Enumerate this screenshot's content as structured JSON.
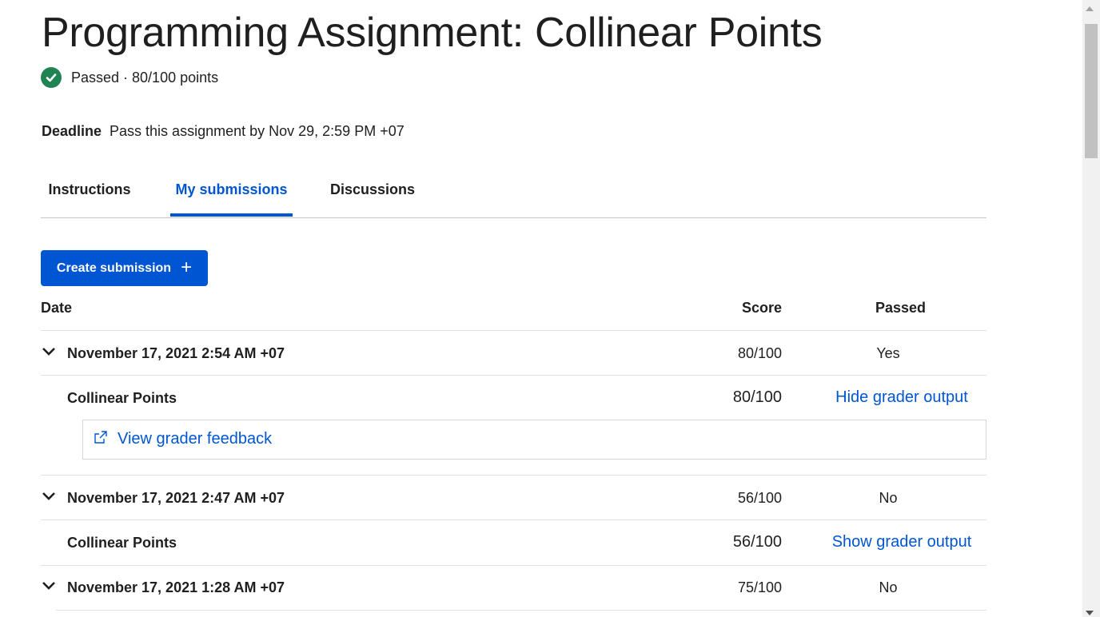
{
  "page": {
    "title": "Programming Assignment: Collinear Points",
    "status": "Passed · 80/100 points",
    "deadline_label": "Deadline",
    "deadline_text": "Pass this assignment by Nov 29, 2:59 PM +07"
  },
  "tabs": [
    {
      "label": "Instructions",
      "active": false
    },
    {
      "label": "My submissions",
      "active": true
    },
    {
      "label": "Discussions",
      "active": false
    }
  ],
  "create_button": {
    "label": "Create submission"
  },
  "table": {
    "headers": {
      "date": "Date",
      "score": "Score",
      "passed": "Passed"
    },
    "submissions": [
      {
        "date": "November 17, 2021 2:54 AM +07",
        "score": "80/100",
        "passed": "Yes",
        "expanded": true,
        "item": {
          "name": "Collinear Points",
          "score": "80/100",
          "toggle": "Hide grader output",
          "feedback_link": "View grader feedback"
        }
      },
      {
        "date": "November 17, 2021 2:47 AM +07",
        "score": "56/100",
        "passed": "No",
        "expanded": true,
        "item": {
          "name": "Collinear Points",
          "score": "56/100",
          "toggle": "Show grader output"
        }
      },
      {
        "date": "November 17, 2021 1:28 AM +07",
        "score": "75/100",
        "passed": "No",
        "expanded": false
      }
    ]
  },
  "colors": {
    "accent": "#0056d2",
    "success": "#1f8354",
    "text": "#1f1f1f",
    "divider": "#e1e1e1"
  },
  "icons": {
    "status": "check-circle-icon",
    "expand": "chevron-down-icon",
    "external": "external-link-icon",
    "add": "plus-icon"
  }
}
